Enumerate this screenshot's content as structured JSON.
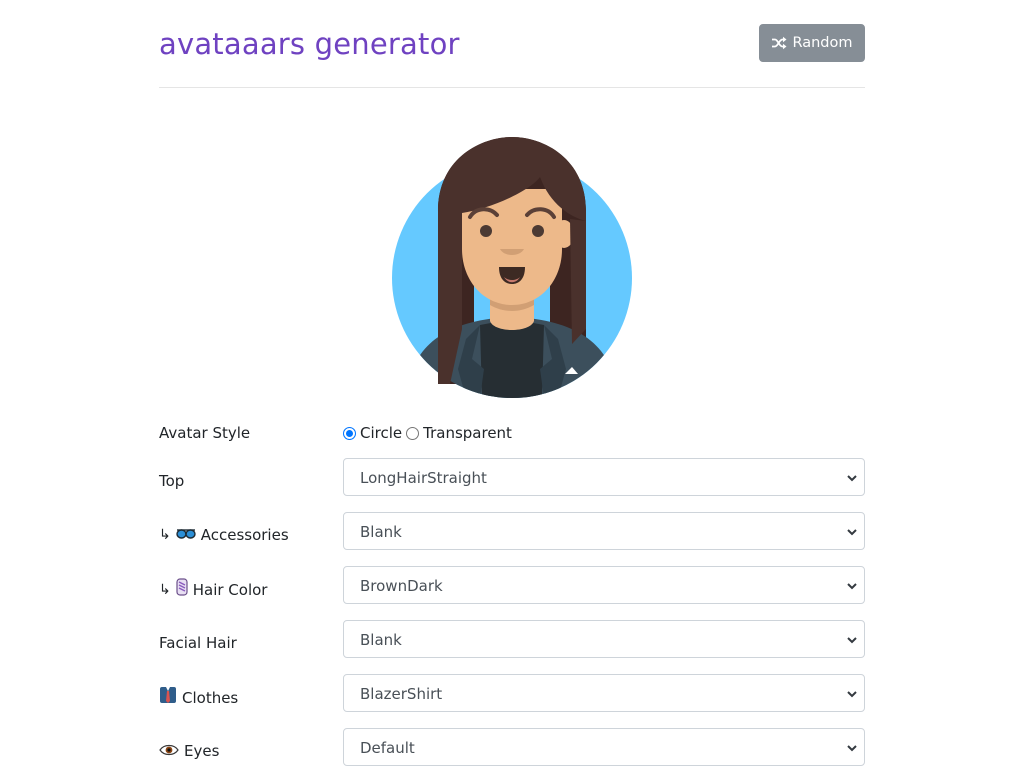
{
  "header": {
    "title": "avataaars generator",
    "random_label": "Random"
  },
  "colors": {
    "title": "#6f42c1",
    "random_button": "#868e96",
    "avatar_background": "#65c9ff",
    "skin": "#edb98a",
    "hair": "#4a312c",
    "blazer": "#3c4f5c",
    "shirt": "#262e33"
  },
  "avatar_style": {
    "label": "Avatar Style",
    "options": [
      "Circle",
      "Transparent"
    ],
    "selected": "Circle"
  },
  "fields": [
    {
      "label": "Top",
      "prefix": "",
      "icon": "",
      "value": "LongHairStraight"
    },
    {
      "label": "Accessories",
      "prefix": "↳",
      "icon": "sunglasses-icon",
      "value": "Blank"
    },
    {
      "label": "Hair Color",
      "prefix": "↳",
      "icon": "hair-color-icon",
      "value": "BrownDark"
    },
    {
      "label": "Facial Hair",
      "prefix": "",
      "icon": "",
      "value": "Blank"
    },
    {
      "label": "Clothes",
      "prefix": "",
      "icon": "clothes-icon",
      "value": "BlazerShirt"
    },
    {
      "label": "Eyes",
      "prefix": "",
      "icon": "eye-icon",
      "value": "Default"
    }
  ]
}
